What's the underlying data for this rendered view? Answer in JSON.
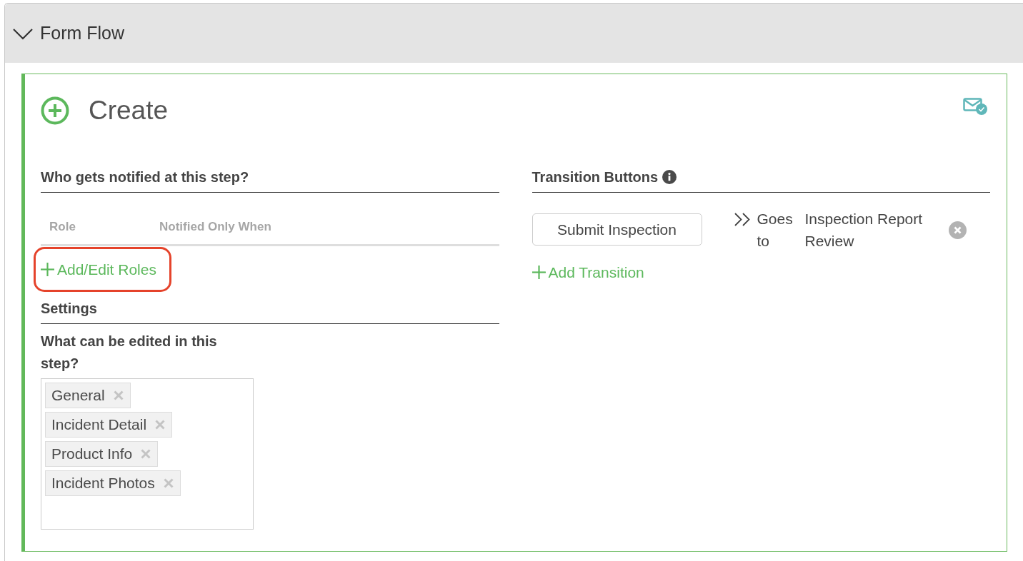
{
  "section": {
    "title": "Form Flow",
    "expanded": true
  },
  "step": {
    "title": "Create",
    "notifications": {
      "heading": "Who gets notified at this step?",
      "columns": [
        "Role",
        "Notified Only When"
      ],
      "add_link": {
        "label": "Add/Edit Roles",
        "highlighted": true
      }
    },
    "settings": {
      "heading": "Settings",
      "editable_label": "What can be edited in this step?",
      "editable_tags": [
        {
          "label": "General"
        },
        {
          "label": "Incident Detail"
        },
        {
          "label": "Product Info"
        },
        {
          "label": "Incident Photos"
        }
      ]
    },
    "transitions": {
      "heading": "Transition Buttons",
      "items": [
        {
          "button": "Submit Inspection",
          "goes_to": "Goes to",
          "target": "Inspection Report Review"
        }
      ],
      "add_link": "Add Transition"
    }
  }
}
